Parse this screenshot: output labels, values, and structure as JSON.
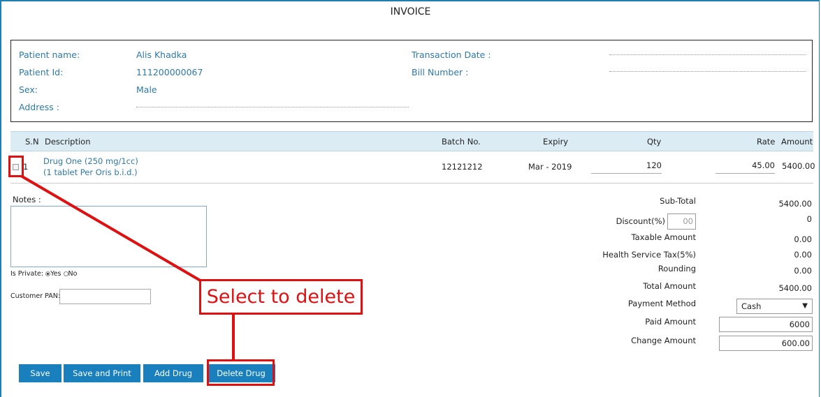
{
  "page": {
    "title": "INVOICE"
  },
  "patient": {
    "name_label": "Patient name:",
    "name": "Alis Khadka",
    "id_label": "Patient Id:",
    "id": "111200000067",
    "sex_label": "Sex:",
    "sex": "Male",
    "address_label": "Address :",
    "transaction_date_label": "Transaction Date :",
    "bill_number_label": "Bill Number :"
  },
  "table": {
    "headers": {
      "sn": "S.N",
      "description": "Description",
      "batch": "Batch No.",
      "expiry": "Expiry",
      "qty": "Qty",
      "rate": "Rate",
      "amount": "Amount"
    },
    "rows": [
      {
        "sn": "1",
        "drug": "Drug One (250 mg/1cc)",
        "dosage": "(1 tablet Per Oris b.i.d.)",
        "batch": "12121212",
        "expiry": "Mar - 2019",
        "qty": "120",
        "rate": "45.00",
        "amount": "5400.00"
      }
    ]
  },
  "notes": {
    "label": "Notes :",
    "value": ""
  },
  "private": {
    "label": "Is Private:",
    "yes": "Yes",
    "no": "No",
    "selected": "Yes"
  },
  "pan": {
    "label": "Customer PAN:",
    "value": ""
  },
  "summary": {
    "subtotal_label": "Sub-Total",
    "subtotal": "5400.00",
    "discount_label": "Discount(%)",
    "discount_placeholder": "00",
    "discount": "0",
    "taxable_label": "Taxable Amount",
    "taxable": "0.00",
    "tax_label": "Health Service Tax(5%)",
    "tax": "0.00",
    "rounding_label": "Rounding",
    "rounding": "0.00",
    "total_label": "Total Amount",
    "total": "5400.00",
    "payment_label": "Payment Method",
    "payment": "Cash",
    "paid_label": "Paid Amount",
    "paid": "6000",
    "change_label": "Change Amount",
    "change": "600.00"
  },
  "buttons": {
    "save": "Save",
    "save_print": "Save and Print",
    "add": "Add Drug",
    "delete": "Delete Drug"
  },
  "annotation": {
    "text": "Select to delete",
    "color": "#e01010"
  },
  "colors": {
    "accent": "#1a80bd",
    "label": "#2d7aa8",
    "header_bg": "#dcecf4"
  }
}
